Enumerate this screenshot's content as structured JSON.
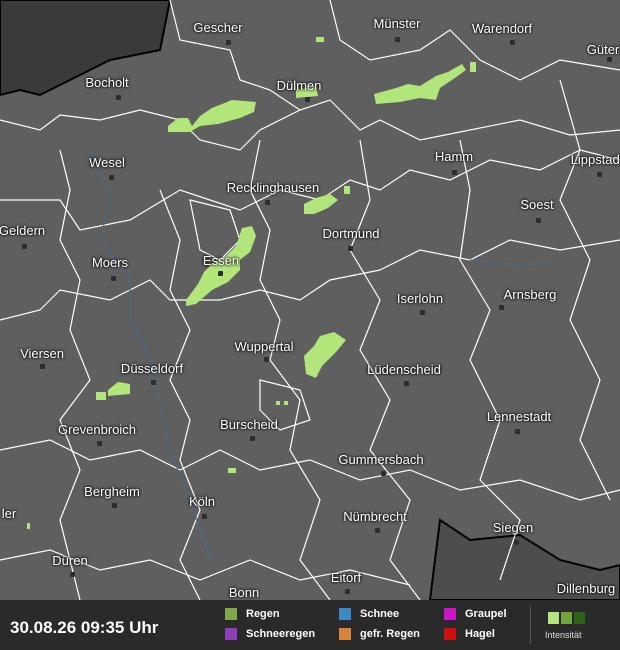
{
  "timestamp": "30.08.26 09:35 Uhr",
  "cities": [
    "Gescher",
    "Münster",
    "Warendorf",
    "Güter",
    "Bocholt",
    "Dülmen",
    "Hamm",
    "Lippstadt",
    "Wesel",
    "Recklinghausen",
    "Soest",
    "Dortmund",
    "Geldern",
    "Moers",
    "Essen",
    "Iserlohn",
    "Arnsberg",
    "Viersen",
    "Wuppertal",
    "Düsseldorf",
    "Lüdenscheid",
    "Lennestadt",
    "Grevenbroich",
    "Burscheid",
    "Gummersbach",
    "Bergheim",
    "Köln",
    "ler",
    "Nümbrecht",
    "Siegen",
    "Düren",
    "Eitorf",
    "Bonn",
    "Dillenburg"
  ],
  "legend": {
    "rain": "Regen",
    "sleet": "Schneeregen",
    "snow": "Schnee",
    "freezing_rain": "gefr. Regen",
    "graupel": "Graupel",
    "hail": "Hagel",
    "intensity": "Intensität"
  },
  "colors": {
    "background": "#5f5f5f",
    "rain_precip": "#b2e57a",
    "rain": "#7ea84a",
    "sleet": "#8b3fb8",
    "snow": "#3a8bc4",
    "freezing_rain": "#d9843a",
    "graupel": "#cc14c8",
    "hail": "#cc1010",
    "intensity_low": "#b2e57a",
    "intensity_mid": "#6fa53a",
    "intensity_high": "#2f6418"
  }
}
